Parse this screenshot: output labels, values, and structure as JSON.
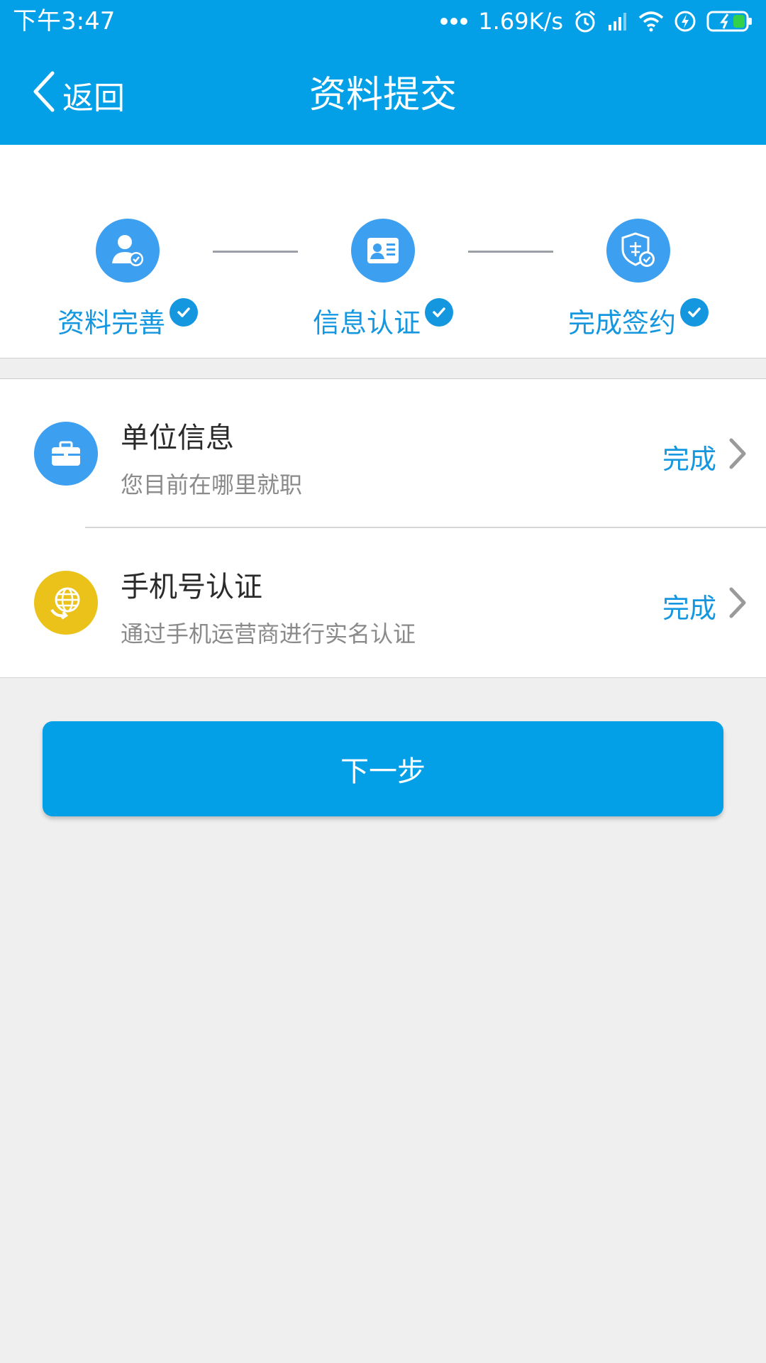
{
  "status_bar": {
    "time": "下午3:47",
    "net_speed": "1.69K/s"
  },
  "navbar": {
    "back_label": "返回",
    "title": "资料提交"
  },
  "steps": [
    {
      "label": "资料完善",
      "icon": "user-check-icon",
      "done": true
    },
    {
      "label": "信息认证",
      "icon": "id-card-icon",
      "done": true
    },
    {
      "label": "完成签约",
      "icon": "shield-certificate-icon",
      "done": true
    }
  ],
  "items": [
    {
      "title": "单位信息",
      "subtitle": "您目前在哪里就职",
      "status": "完成",
      "icon": "briefcase-icon",
      "icon_color": "#3d9ff0"
    },
    {
      "title": "手机号认证",
      "subtitle": "通过手机运营商进行实名认证",
      "status": "完成",
      "icon": "globe-sync-icon",
      "icon_color": "#eac21a"
    }
  ],
  "next_button": {
    "label": "下一步"
  },
  "colors": {
    "primary": "#03a0e8",
    "step_blue": "#3d9ff0",
    "status_blue": "#1597e0",
    "yellow": "#eac21a",
    "background": "#efefef"
  }
}
